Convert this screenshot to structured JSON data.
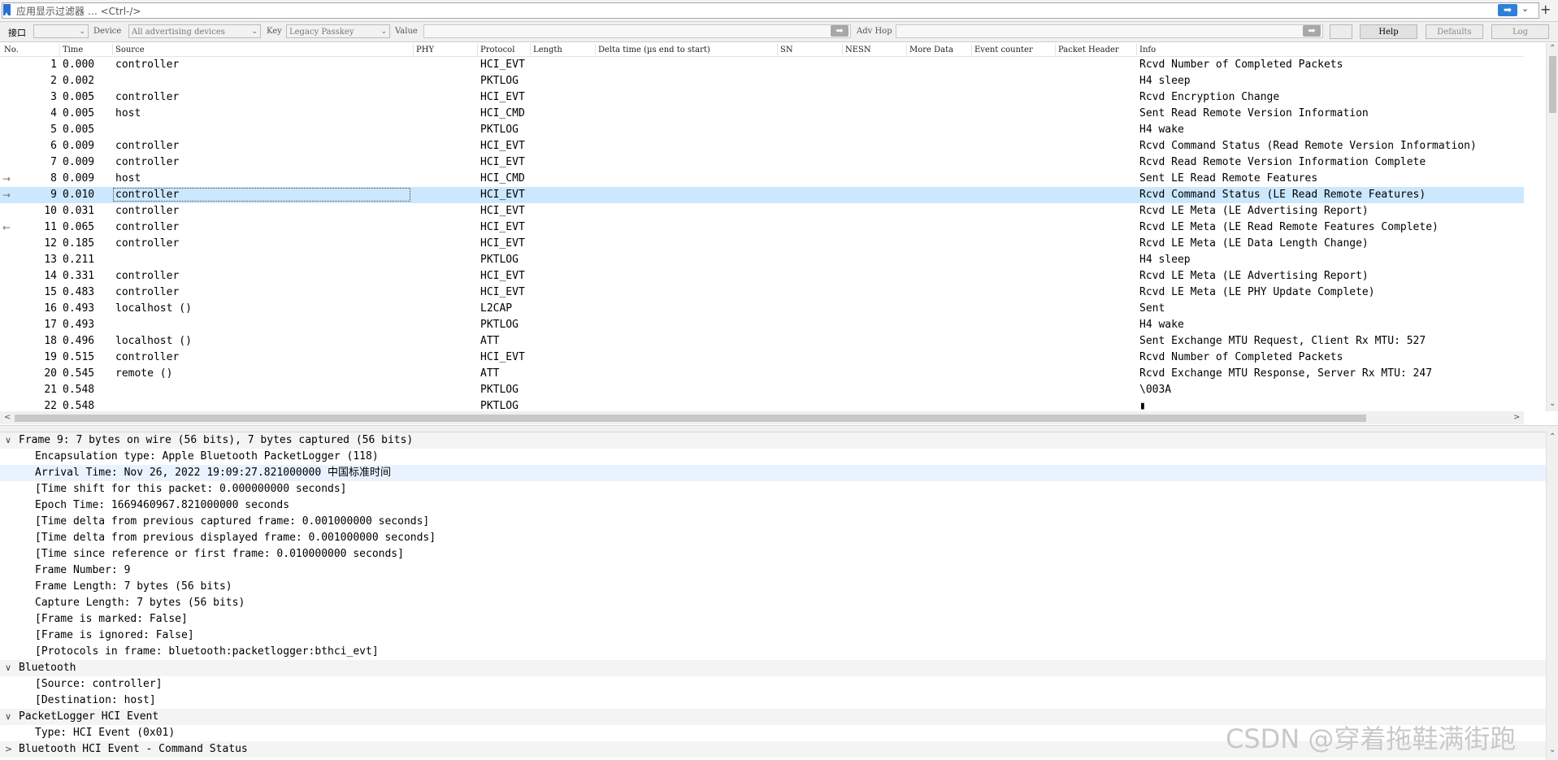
{
  "filter": {
    "placeholder": "应用显示过滤器 … <Ctrl-/>",
    "apply_icon": "arrow-right-icon",
    "add_icon": "plus-icon"
  },
  "toolbar": {
    "interface_label": "接口",
    "interface_value": "",
    "device_label": "Device",
    "device_value": "All advertising devices",
    "key_label": "Key",
    "key_value": "Legacy Passkey",
    "value_label": "Value",
    "adv_hop_label": "Adv Hop",
    "help_label": "Help",
    "defaults_label": "Defaults",
    "log_label": "Log"
  },
  "packet_list": {
    "columns": [
      "No.",
      "Time",
      "Source",
      "PHY",
      "Protocol",
      "Length",
      "Delta time (µs end to start)",
      "SN",
      "NESN",
      "More Data",
      "Event counter",
      "Packet Header",
      "Info"
    ],
    "rows": [
      {
        "no": "1",
        "time": "0.000",
        "source": "controller",
        "protocol": "HCI_EVT",
        "info": "Rcvd Number of Completed Packets"
      },
      {
        "no": "2",
        "time": "0.002",
        "source": "",
        "protocol": "PKTLOG",
        "info": "H4 sleep"
      },
      {
        "no": "3",
        "time": "0.005",
        "source": "controller",
        "protocol": "HCI_EVT",
        "info": "Rcvd Encryption Change"
      },
      {
        "no": "4",
        "time": "0.005",
        "source": "host",
        "protocol": "HCI_CMD",
        "info": "Sent Read Remote Version Information"
      },
      {
        "no": "5",
        "time": "0.005",
        "source": "",
        "protocol": "PKTLOG",
        "info": "H4 wake"
      },
      {
        "no": "6",
        "time": "0.009",
        "source": "controller",
        "protocol": "HCI_EVT",
        "info": "Rcvd Command Status (Read Remote Version Information)"
      },
      {
        "no": "7",
        "time": "0.009",
        "source": "controller",
        "protocol": "HCI_EVT",
        "info": "Rcvd Read Remote Version Information Complete"
      },
      {
        "no": "8",
        "time": "0.009",
        "source": "host",
        "protocol": "HCI_CMD",
        "info": "Sent LE Read Remote Features",
        "marker": "→"
      },
      {
        "no": "9",
        "time": "0.010",
        "source": "controller",
        "protocol": "HCI_EVT",
        "info": "Rcvd Command Status (LE Read Remote Features)",
        "selected": true,
        "marker": "→"
      },
      {
        "no": "10",
        "time": "0.031",
        "source": "controller",
        "protocol": "HCI_EVT",
        "info": "Rcvd LE Meta (LE Advertising Report)"
      },
      {
        "no": "11",
        "time": "0.065",
        "source": "controller",
        "protocol": "HCI_EVT",
        "info": "Rcvd LE Meta (LE Read Remote Features Complete)",
        "marker": "←"
      },
      {
        "no": "12",
        "time": "0.185",
        "source": "controller",
        "protocol": "HCI_EVT",
        "info": "Rcvd LE Meta (LE Data Length Change)"
      },
      {
        "no": "13",
        "time": "0.211",
        "source": "",
        "protocol": "PKTLOG",
        "info": "H4 sleep"
      },
      {
        "no": "14",
        "time": "0.331",
        "source": "controller",
        "protocol": "HCI_EVT",
        "info": "Rcvd LE Meta (LE Advertising Report)"
      },
      {
        "no": "15",
        "time": "0.483",
        "source": "controller",
        "protocol": "HCI_EVT",
        "info": "Rcvd LE Meta (LE PHY Update Complete)"
      },
      {
        "no": "16",
        "time": "0.493",
        "source": "localhost ()",
        "protocol": "L2CAP",
        "info": "Sent"
      },
      {
        "no": "17",
        "time": "0.493",
        "source": "",
        "protocol": "PKTLOG",
        "info": "H4 wake"
      },
      {
        "no": "18",
        "time": "0.496",
        "source": "localhost ()",
        "protocol": "ATT",
        "info": "Sent Exchange MTU Request, Client Rx MTU: 527"
      },
      {
        "no": "19",
        "time": "0.515",
        "source": "controller",
        "protocol": "HCI_EVT",
        "info": "Rcvd Number of Completed Packets"
      },
      {
        "no": "20",
        "time": "0.545",
        "source": "remote ()",
        "protocol": "ATT",
        "info": "Rcvd Exchange MTU Response, Server Rx MTU: 247"
      },
      {
        "no": "21",
        "time": "0.548",
        "source": "",
        "protocol": "PKTLOG",
        "info": "\\003A"
      },
      {
        "no": "22",
        "time": "0.548",
        "source": "",
        "protocol": "PKTLOG",
        "info": "▮"
      }
    ]
  },
  "detail": {
    "rows": [
      {
        "level": 0,
        "toggle": "∨",
        "text": "Frame 9: 7 bytes on wire (56 bits), 7 bytes captured (56 bits)",
        "header": true
      },
      {
        "level": 1,
        "text": "Encapsulation type: Apple Bluetooth PacketLogger (118)"
      },
      {
        "level": 1,
        "text": "Arrival Time: Nov 26, 2022 19:09:27.821000000 中国标准时间",
        "highlight": true
      },
      {
        "level": 1,
        "text": "[Time shift for this packet: 0.000000000 seconds]"
      },
      {
        "level": 1,
        "text": "Epoch Time: 1669460967.821000000 seconds"
      },
      {
        "level": 1,
        "text": "[Time delta from previous captured frame: 0.001000000 seconds]"
      },
      {
        "level": 1,
        "text": "[Time delta from previous displayed frame: 0.001000000 seconds]"
      },
      {
        "level": 1,
        "text": "[Time since reference or first frame: 0.010000000 seconds]"
      },
      {
        "level": 1,
        "text": "Frame Number: 9"
      },
      {
        "level": 1,
        "text": "Frame Length: 7 bytes (56 bits)"
      },
      {
        "level": 1,
        "text": "Capture Length: 7 bytes (56 bits)"
      },
      {
        "level": 1,
        "text": "[Frame is marked: False]"
      },
      {
        "level": 1,
        "text": "[Frame is ignored: False]"
      },
      {
        "level": 1,
        "text": "[Protocols in frame: bluetooth:packetlogger:bthci_evt]"
      },
      {
        "level": 0,
        "toggle": "∨",
        "text": "Bluetooth",
        "header": true
      },
      {
        "level": 1,
        "text": "[Source: controller]"
      },
      {
        "level": 1,
        "text": "[Destination: host]"
      },
      {
        "level": 0,
        "toggle": "∨",
        "text": "PacketLogger HCI Event",
        "header": true
      },
      {
        "level": 1,
        "text": "Type: HCI Event (0x01)"
      },
      {
        "level": 0,
        "toggle": ">",
        "text": "Bluetooth HCI Event - Command Status",
        "header": true
      }
    ]
  },
  "watermark": "CSDN @穿着拖鞋满街跑"
}
